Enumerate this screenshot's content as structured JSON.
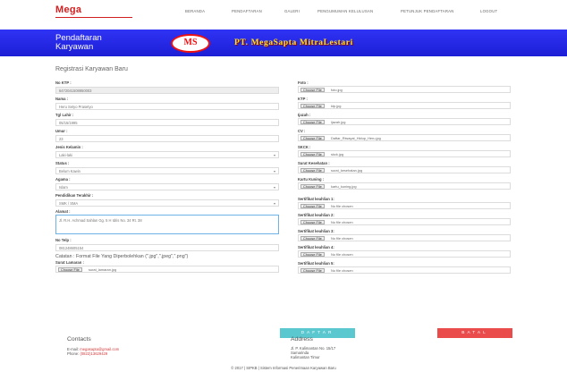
{
  "brand": {
    "logo": "Mega"
  },
  "nav": [
    {
      "label": "BERANDA"
    },
    {
      "label": "PENDAFTARAN"
    },
    {
      "label": "GALERI"
    },
    {
      "label": "PENGUMUMAN KELULUSAN"
    },
    {
      "label": "PETUNJUK PENDAFTARAN"
    },
    {
      "label": "LOGOUT"
    }
  ],
  "banner": {
    "title_line1": "Pendaftaran",
    "title_line2": "Karyawan",
    "logo_text": "MS",
    "company": "PT. MegaSapta MitraLestari"
  },
  "heading": "Registrasi Karyawan Baru",
  "left": {
    "no_ktp": {
      "label": "No KTP :",
      "value": "6472041508950003"
    },
    "nama": {
      "label": "Nama :",
      "value": "Heru Setyo Prasetyo"
    },
    "tgl_lahir": {
      "label": "Tgl Lahir :",
      "value": "05/15/1995"
    },
    "umur": {
      "label": "Umur :",
      "value": "23"
    },
    "jenis_kelamin": {
      "label": "Jenis Kelamin :",
      "value": "Laki-laki"
    },
    "status": {
      "label": "Status :",
      "value": "Belum Kawin"
    },
    "agama": {
      "label": "Agama :",
      "value": "Islam"
    },
    "pendidikan": {
      "label": "Pendidikan Terakhir :",
      "value": "SMK / SMA"
    },
    "alamat": {
      "label": "Alamat :",
      "value": "Jl. R.H. Achmad Sahlan Gg. 5 H Idris No. 34 Rt. 38"
    },
    "no_telp": {
      "label": "No Telp :",
      "value": "081248605154"
    },
    "note": "Catatan : Format File Yang Diperbolehkan (\".jpg\",\".jpeg\",\".png\")",
    "surat_lamaran": {
      "label": "Surat Lamaran :",
      "button": "Choose File",
      "file": "surat_lamaran.jpg"
    }
  },
  "right": {
    "files": [
      {
        "label": "Foto :",
        "button": "Choose File",
        "file": "foto.jpg"
      },
      {
        "label": "KTP :",
        "button": "Choose File",
        "file": "ktp.jpg"
      },
      {
        "label": "Ijazah :",
        "button": "Choose File",
        "file": "ijazah.jpg"
      },
      {
        "label": "CV :",
        "button": "Choose File",
        "file": "Daftar_Riwayat_Hidup_Heru.jpg"
      },
      {
        "label": "SKCK :",
        "button": "Choose File",
        "file": "skck.jpg"
      },
      {
        "label": "Surat Kesehatan :",
        "button": "Choose File",
        "file": "surat_kesehatan.jpg"
      },
      {
        "label": "Kartu Kuning :",
        "button": "Choose File",
        "file": "kartu_kuning.jpg"
      },
      {
        "label": "Sertifikat keahlian 1:",
        "button": "Choose File",
        "file": "No file chosen"
      },
      {
        "label": "Sertifikat keahlian 2:",
        "button": "Choose File",
        "file": "No file chosen"
      },
      {
        "label": "Sertifikat keahlian 3:",
        "button": "Choose File",
        "file": "No file chosen"
      },
      {
        "label": "Sertifikat keahlian 4:",
        "button": "Choose File",
        "file": "No file chosen"
      },
      {
        "label": "Sertifikat keahlian 5:",
        "button": "Choose File",
        "file": "No file chosen"
      }
    ]
  },
  "buttons": {
    "daftar": "DAFTAR",
    "batal": "BATAL"
  },
  "footer": {
    "contacts_title": "Contacts",
    "email_label": "E-mail:",
    "email": "megasapta@gmail.com",
    "phone_label": "Phone:",
    "phone": "(0822)13629429",
    "address_title": "Address",
    "address_line1": "Jl. P. Kalimantan No. 15/17",
    "address_line2": "Samarinda",
    "address_line3": "Kalimantan Timur",
    "copyright": "© 2017 | SIPKB | Sistem Informasi Penerimaan Karyawan Baru"
  }
}
